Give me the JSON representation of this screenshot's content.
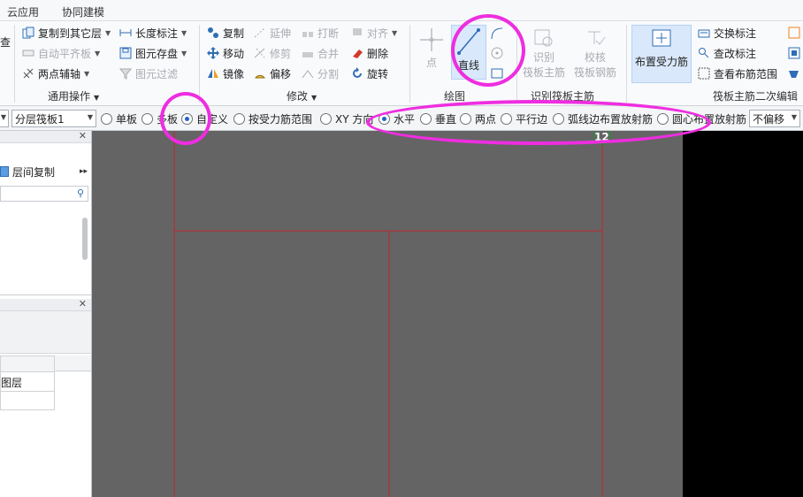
{
  "menu": {
    "tabs": [
      "云应用",
      "协同建模"
    ]
  },
  "ribbon": {
    "general_ops": {
      "label": "通用操作",
      "col1": [
        "查"
      ],
      "col2": [
        "复制到其它层",
        "自动平齐板",
        "两点辅轴"
      ],
      "col3": [
        "长度标注",
        "图元存盘",
        "图元过滤"
      ]
    },
    "modify": {
      "label": "修改",
      "col1": [
        "复制",
        "移动",
        "镜像"
      ],
      "col2": [
        "延伸",
        "修剪",
        "偏移"
      ],
      "col3": [
        "打断",
        "合并",
        "分割"
      ],
      "col4": [
        "对齐",
        "删除",
        "旋转"
      ]
    },
    "draw": {
      "label": "绘图",
      "point": "点",
      "line": "直线"
    },
    "identify": {
      "label": "识别筏板主筋",
      "identify_btn": [
        "识别",
        "筏板主筋"
      ],
      "check_btn": [
        "校核",
        "筏板钢筋"
      ]
    },
    "layout": {
      "label": "筏板主筋二次编辑",
      "place_btn": "布置受力筋",
      "items": [
        "交换标注",
        "查改标注",
        "查看布筋范围"
      ]
    }
  },
  "optbar": {
    "layer_select": "分层筏板1",
    "options": [
      {
        "label": "单板",
        "checked": false
      },
      {
        "label": "多板",
        "checked": true
      },
      {
        "label": "自定义",
        "checked": false
      },
      {
        "label": "按受力筋范围",
        "checked": false
      },
      {
        "label": "XY 方向",
        "checked": false
      },
      {
        "label": "水平",
        "checked": true
      },
      {
        "label": "垂直",
        "checked": false
      },
      {
        "label": "两点",
        "checked": false
      },
      {
        "label": "平行边",
        "checked": false
      },
      {
        "label": "弧线边布置放射筋",
        "checked": false
      },
      {
        "label": "圆心布置放射筋",
        "checked": false
      }
    ],
    "offset_select": "不偏移"
  },
  "left_panel": {
    "floor_copy": "层间复制",
    "layer_label": "图层"
  },
  "canvas": {
    "axis_label": "12"
  },
  "colors": {
    "canvas_bg": "#646464",
    "grid_line": "#c2262e",
    "highlight": "#ee2de0",
    "axis_bubble": "#2d8a3e"
  }
}
